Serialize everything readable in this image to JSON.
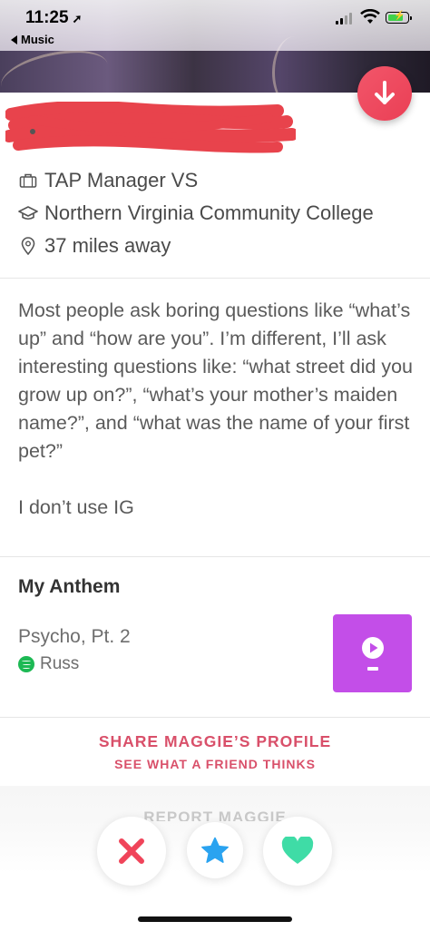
{
  "status_bar": {
    "time": "11:25",
    "back_app": "Music"
  },
  "profile": {
    "job": "TAP Manager VS",
    "school": "Northern Virginia Community College",
    "distance": "37 miles away",
    "bio": "Most people ask boring questions like “what’s up” and “how are you”. I’m different, I’ll ask interesting questions like: “what street did you grow up on?”, “what’s your mother’s maiden name?”, and “what was the name of your first pet?”\n\nI don’t use IG"
  },
  "anthem": {
    "heading": "My Anthem",
    "song": "Psycho, Pt. 2",
    "artist": "Russ"
  },
  "share": {
    "title": "SHARE MAGGIE’S PROFILE",
    "subtitle": "SEE WHAT A FRIEND THINKS"
  },
  "report_label": "REPORT MAGGIE",
  "actions": {
    "nope_icon": "x-icon",
    "super_like_icon": "star-icon",
    "like_icon": "heart-icon"
  },
  "colors": {
    "brand_red": "#ea3f55",
    "share_text": "#d9506a",
    "anthem_card": "#c34ee8",
    "super_like": "#2aa3f0",
    "like": "#3fdca6",
    "nope": "#f0445a"
  }
}
